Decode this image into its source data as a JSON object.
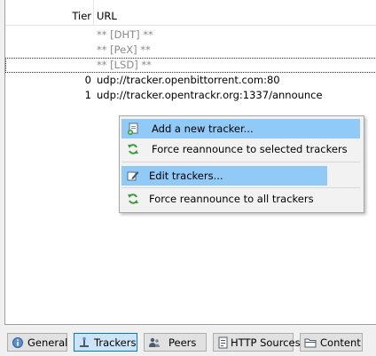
{
  "trackers": {
    "columns": {
      "tier": "Tier",
      "url": "URL"
    },
    "rows": [
      {
        "tier": "",
        "url": "** [DHT] **"
      },
      {
        "tier": "",
        "url": "** [PeX] **"
      },
      {
        "tier": "",
        "url": "** [LSD] **"
      },
      {
        "tier": "0",
        "url": "udp://tracker.openbittorrent.com:80"
      },
      {
        "tier": "1",
        "url": "udp://tracker.opentrackr.org:1337/announce"
      }
    ]
  },
  "context_menu": {
    "items": [
      {
        "label": "Add a new tracker...",
        "icon": "add-tracker-icon"
      },
      {
        "label": "Force reannounce to selected trackers",
        "icon": "refresh-icon"
      },
      {
        "label": "Edit trackers...",
        "icon": "edit-icon"
      },
      {
        "label": "Force reannounce to all trackers",
        "icon": "refresh-icon"
      }
    ]
  },
  "tabs": [
    {
      "label": "General",
      "icon": "general-icon"
    },
    {
      "label": "Trackers",
      "icon": "trackers-icon"
    },
    {
      "label": "Peers",
      "icon": "peers-icon"
    },
    {
      "label": "HTTP Sources",
      "icon": "http-sources-icon"
    },
    {
      "label": "Content",
      "icon": "folder-icon"
    }
  ],
  "colors": {
    "highlight": "#91c9f7",
    "active_tab": "#cce4f7",
    "dim_text": "#8a8a8a",
    "refresh_green": "#3a9b3a"
  }
}
